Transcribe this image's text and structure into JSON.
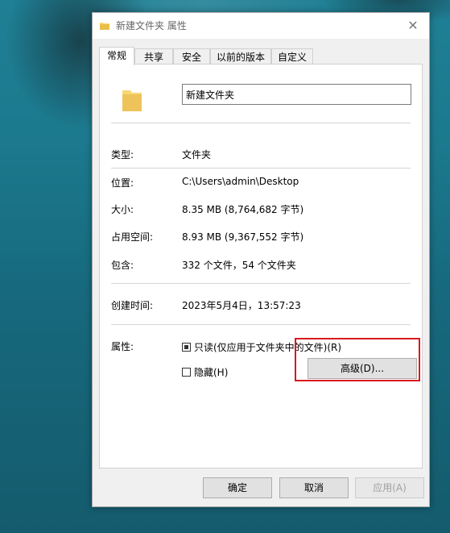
{
  "window": {
    "title": "新建文件夹 属性",
    "close_glyph": "✕"
  },
  "tabs": [
    {
      "label": "常规",
      "active": true
    },
    {
      "label": "共享",
      "active": false
    },
    {
      "label": "安全",
      "active": false
    },
    {
      "label": "以前的版本",
      "active": false
    },
    {
      "label": "自定义",
      "active": false
    }
  ],
  "general": {
    "folder_name": "新建文件夹",
    "type_label": "类型:",
    "type_value": "文件夹",
    "location_label": "位置:",
    "location_value": "C:\\Users\\admin\\Desktop",
    "size_label": "大小:",
    "size_value": "8.35 MB (8,764,682 字节)",
    "disk_size_label": "占用空间:",
    "disk_size_value": "8.93 MB (9,367,552 字节)",
    "contains_label": "包含:",
    "contains_value": "332 个文件，54 个文件夹",
    "created_label": "创建时间:",
    "created_value": "2023年5月4日，13:57:23",
    "attributes_label": "属性:",
    "readonly_label": "只读(仅应用于文件夹中的文件)(R)",
    "readonly_state": "indeterminate",
    "hidden_label": "隐藏(H)",
    "hidden_state": "unchecked",
    "advanced_button": "高级(D)..."
  },
  "buttons": {
    "ok": "确定",
    "cancel": "取消",
    "apply": "应用(A)"
  },
  "colors": {
    "highlight": "#d8191e",
    "folder_yellow": "#f8d775"
  },
  "icons": {
    "title": "folder-icon",
    "large": "folder-icon"
  }
}
